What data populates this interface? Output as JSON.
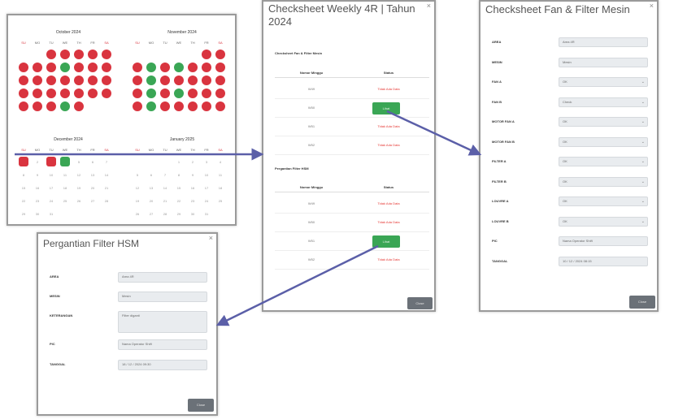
{
  "calendar": {
    "months": [
      "October 2024",
      "November 2024",
      "December 2024",
      "January 2025"
    ],
    "weekdays": [
      "SU",
      "MO",
      "TU",
      "WE",
      "TH",
      "FR",
      "SA"
    ],
    "colors": {
      "ok": "#3aa655",
      "missing": "#d9343f",
      "weekend": "#d9343f"
    },
    "october": {
      "leading_blank": 2,
      "days": 31,
      "green": [
        9,
        30
      ]
    },
    "november": {
      "leading_blank": 5,
      "days": 30,
      "green": [
        4,
        6,
        11,
        18,
        20,
        25
      ]
    },
    "december": {
      "leading_blank": 0,
      "days": 31,
      "marked": [
        1,
        3,
        4
      ],
      "green": [
        4
      ]
    },
    "january": {
      "leading_blank": 3,
      "days": 31
    }
  },
  "weekly": {
    "title": "Checksheet Weekly 4R | Tahun 2024",
    "section1": "Checksheet Fan & Filter Mesin",
    "section2": "Pergantian Filter HSM",
    "col_week": "Nomor Minggu",
    "col_status": "Status",
    "rows1": [
      {
        "week": "W49",
        "status": "Tidak Ada Data",
        "filled": false
      },
      {
        "week": "W50",
        "status": "Lihat",
        "filled": true
      },
      {
        "week": "W51",
        "status": "Tidak Ada Data",
        "filled": false
      },
      {
        "week": "W52",
        "status": "Tidak Ada Data",
        "filled": false
      }
    ],
    "rows2": [
      {
        "week": "W49",
        "status": "Tidak Ada Data",
        "filled": false
      },
      {
        "week": "W50",
        "status": "Tidak Ada Data",
        "filled": false
      },
      {
        "week": "W51",
        "status": "Lihat",
        "filled": true
      },
      {
        "week": "W52",
        "status": "Tidak Ada Data",
        "filled": false
      }
    ],
    "close_label": "Close"
  },
  "fan_filter": {
    "title": "Checksheet Fan & Filter Mesin",
    "fields": [
      {
        "label": "AREA",
        "value": "Area 4R",
        "select": false
      },
      {
        "label": "MESIN",
        "value": "Mesin",
        "select": false
      },
      {
        "label": "FAN A",
        "value": "OK",
        "select": true
      },
      {
        "label": "FAN B",
        "value": "Check",
        "select": true
      },
      {
        "label": "MOTOR FAN A",
        "value": "OK",
        "select": true
      },
      {
        "label": "MOTOR FAN B",
        "value": "OK",
        "select": true
      },
      {
        "label": "FILTER A",
        "value": "OK",
        "select": true
      },
      {
        "label": "FILTER B",
        "value": "OK",
        "select": true
      },
      {
        "label": "LOUVRE A",
        "value": "OK",
        "select": true
      },
      {
        "label": "LOUVRE B",
        "value": "OK",
        "select": true
      },
      {
        "label": "PIC",
        "value": "Nama Operator Shift",
        "select": false
      },
      {
        "label": "TANGGAL",
        "value": "10 / 12 / 2024 08:15",
        "select": false
      }
    ],
    "close_label": "Close"
  },
  "hsm": {
    "title": "Pergantian Filter HSM",
    "fields": [
      {
        "label": "AREA",
        "value": "Area 4R",
        "tall": false
      },
      {
        "label": "MESIN",
        "value": "Mesin",
        "tall": false
      },
      {
        "label": "KETERANGAN",
        "value": "Filter diganti",
        "tall": true
      },
      {
        "label": "PIC",
        "value": "Nama Operator Shift",
        "tall": false
      },
      {
        "label": "TANGGAL",
        "value": "18 / 12 / 2024 09:30",
        "tall": false
      }
    ],
    "close_label": "Close"
  },
  "arrows": {
    "color": "#5b5fa8"
  }
}
